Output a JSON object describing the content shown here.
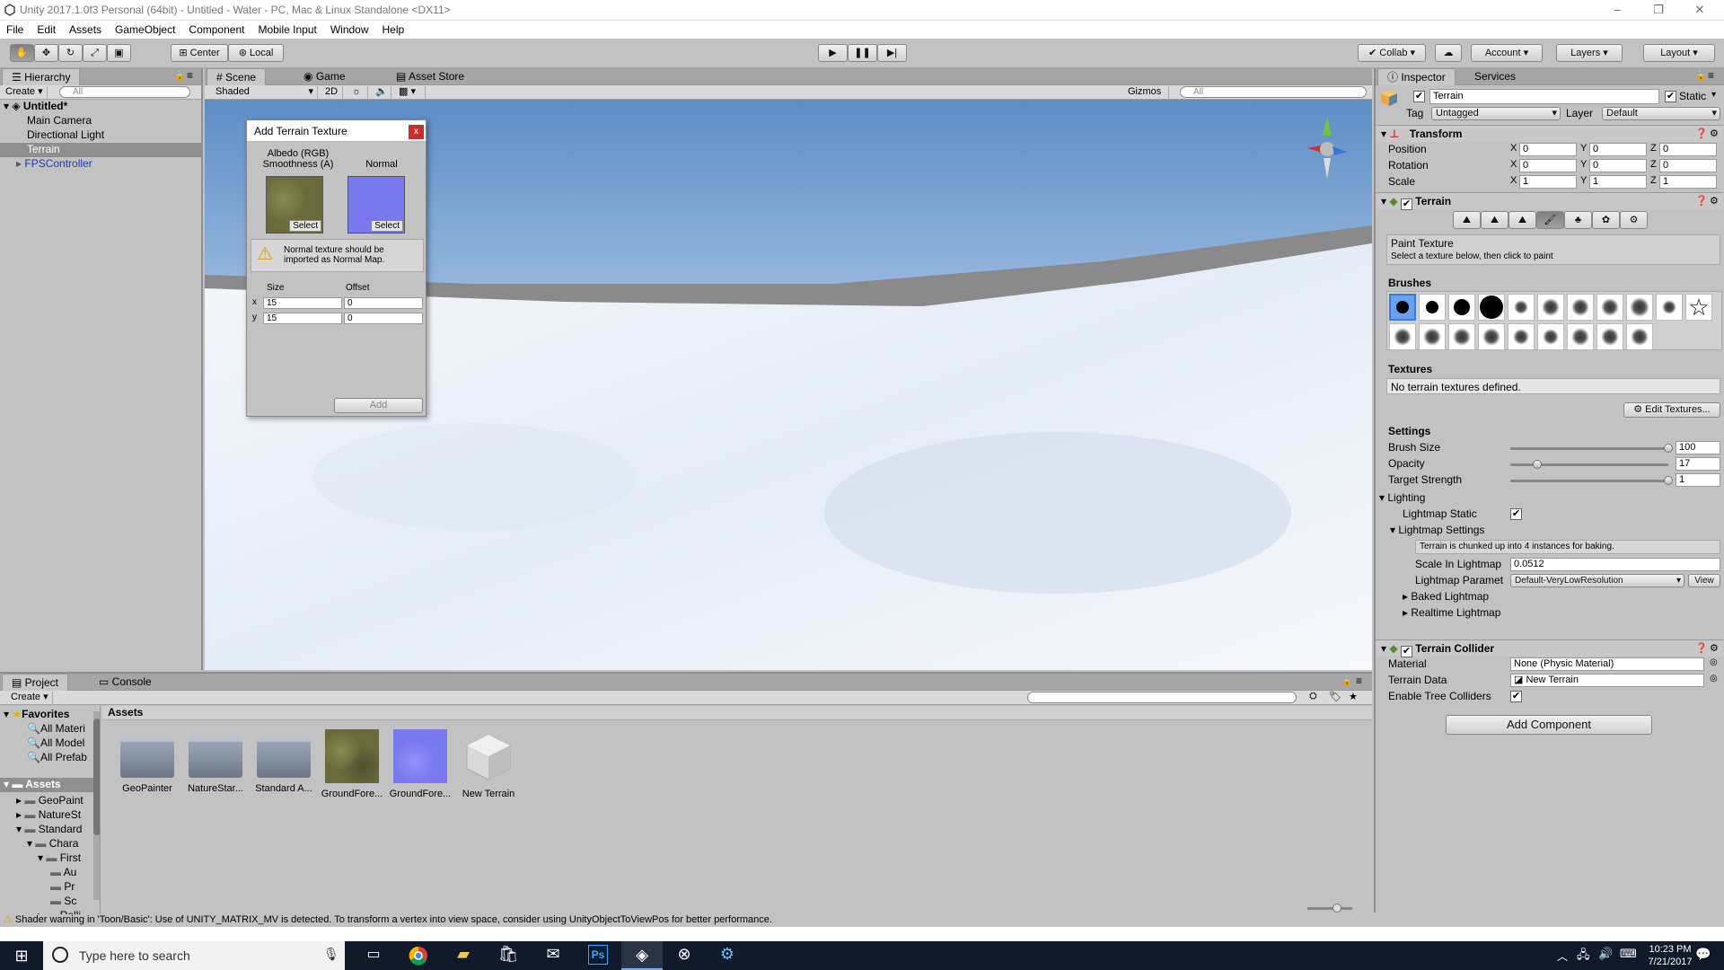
{
  "window": {
    "title": "Unity 2017.1.0f3 Personal (64bit) - Untitled - Water - PC, Mac & Linux Standalone <DX11>",
    "min": "–",
    "max": "❐",
    "close": "✕"
  },
  "menu": [
    "File",
    "Edit",
    "Assets",
    "GameObject",
    "Component",
    "Mobile Input",
    "Window",
    "Help"
  ],
  "toolbar": {
    "center": "Center",
    "local": "Local",
    "collab": "Collab",
    "account": "Account",
    "layers": "Layers",
    "layout": "Layout"
  },
  "hierarchy": {
    "tab": "Hierarchy",
    "create": "Create",
    "search_placeholder": "All",
    "scene": "Untitled*",
    "items": [
      "Main Camera",
      "Directional Light",
      "Terrain",
      "FPSController"
    ]
  },
  "scene": {
    "tabs": [
      "Scene",
      "Game",
      "Asset Store"
    ],
    "shading": "Shaded",
    "mode2d": "2D",
    "gizmos": "Gizmos",
    "search_placeholder": "All"
  },
  "dialog": {
    "title": "Add Terrain Texture",
    "close": "x",
    "albedo_label_1": "Albedo (RGB)",
    "albedo_label_2": "Smoothness (A)",
    "normal_label": "Normal",
    "select": "Select",
    "warning": "Normal texture should be imported as Normal Map.",
    "size": "Size",
    "offset": "Offset",
    "x": "x",
    "y": "y",
    "size_x": "15",
    "offset_x": "0",
    "size_y": "15",
    "offset_y": "0",
    "add": "Add",
    "albedo_color": "#6b6a3c",
    "normal_color": "#7a78ee"
  },
  "inspector": {
    "tabs": [
      "Inspector",
      "Services"
    ],
    "object_name": "Terrain",
    "static": "Static",
    "tag_label": "Tag",
    "tag": "Untagged",
    "layer_label": "Layer",
    "layer": "Default",
    "transform": {
      "title": "Transform",
      "rows": [
        {
          "label": "Position",
          "x": "0",
          "y": "0",
          "z": "0"
        },
        {
          "label": "Rotation",
          "x": "0",
          "y": "0",
          "z": "0"
        },
        {
          "label": "Scale",
          "x": "1",
          "y": "1",
          "z": "1"
        }
      ]
    },
    "terrain": {
      "title": "Terrain",
      "paint_title": "Paint Texture",
      "paint_hint": "Select a texture below, then click to paint",
      "brushes": "Brushes",
      "textures": "Textures",
      "no_textures": "No terrain textures defined.",
      "edit_textures": "Edit Textures...",
      "settings": "Settings",
      "brush_size_label": "Brush Size",
      "brush_size": "100",
      "brush_size_frac": 1.0,
      "opacity_label": "Opacity",
      "opacity": "17",
      "opacity_frac": 0.17,
      "target_label": "Target Strength",
      "target": "1",
      "target_frac": 1.0,
      "lighting": "Lighting",
      "lightmap_static": "Lightmap Static",
      "lightmap_settings": "Lightmap Settings",
      "chunk_info": "Terrain is chunked up into 4 instances for baking.",
      "scale_label": "Scale In Lightmap",
      "scale": "0.0512",
      "param_label": "Lightmap Paramet",
      "param": "Default-VeryLowResolution",
      "view": "View",
      "baked": "Baked Lightmap",
      "realtime": "Realtime Lightmap"
    },
    "collider": {
      "title": "Terrain Collider",
      "material_label": "Material",
      "material": "None (Physic Material)",
      "data_label": "Terrain Data",
      "data": "New Terrain",
      "trees_label": "Enable Tree Colliders"
    },
    "add_component": "Add Component"
  },
  "project": {
    "tabs": [
      "Project",
      "Console"
    ],
    "create": "Create",
    "favorites": "Favorites",
    "fav_items": [
      "All Materi",
      "All Model",
      "All Prefab"
    ],
    "assets_root": "Assets",
    "tree": [
      "GeoPaint",
      "NatureSt",
      "Standard",
      "Chara",
      "First",
      "Au",
      "Pr",
      "Sc",
      "Rolli"
    ],
    "breadcrumb": "Assets",
    "assets": [
      {
        "name": "GeoPainter",
        "kind": "folder"
      },
      {
        "name": "NatureStar...",
        "kind": "folder"
      },
      {
        "name": "Standard A...",
        "kind": "folder"
      },
      {
        "name": "GroundFore...",
        "kind": "albedo"
      },
      {
        "name": "GroundFore...",
        "kind": "normal"
      },
      {
        "name": "New Terrain",
        "kind": "terrain"
      }
    ]
  },
  "status": "Shader warning in 'Toon/Basic': Use of UNITY_MATRIX_MV is detected. To transform a vertex into view space, consider using UnityObjectToViewPos for better performance.",
  "taskbar": {
    "search": "Type here to search",
    "time": "10:23 PM",
    "date": "7/21/2017"
  }
}
